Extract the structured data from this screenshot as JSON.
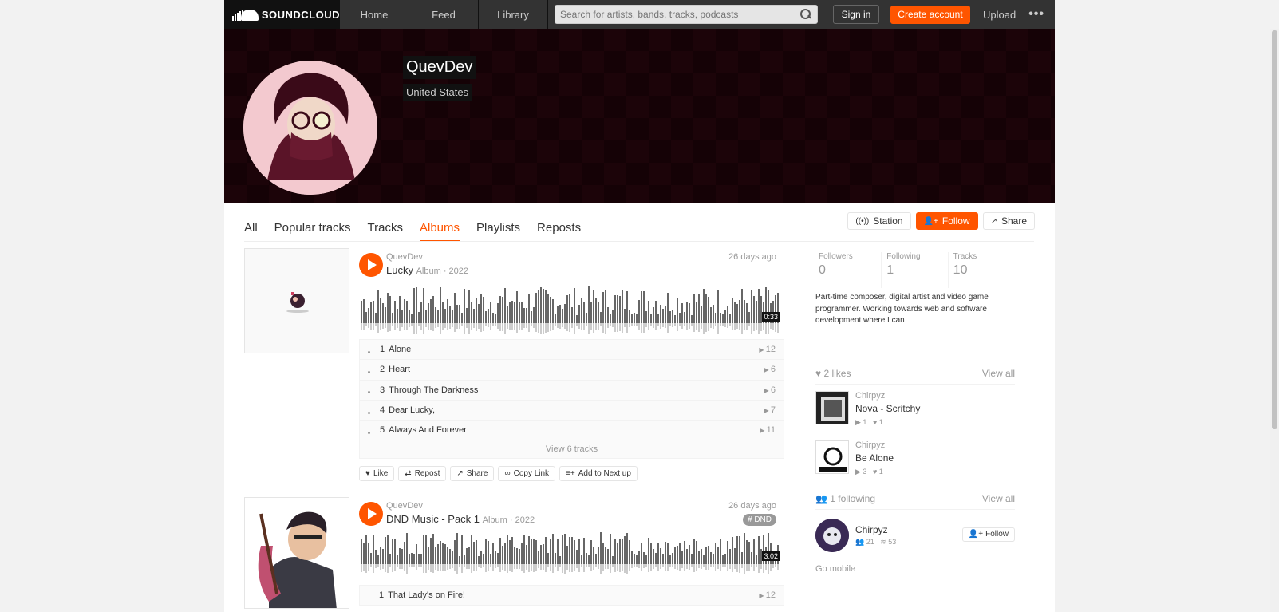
{
  "header": {
    "logo_text": "SOUNDCLOUD",
    "nav": [
      "Home",
      "Feed",
      "Library"
    ],
    "search_placeholder": "Search for artists, bands, tracks, podcasts",
    "signin": "Sign in",
    "create_account": "Create account",
    "upload": "Upload",
    "more": "•••"
  },
  "profile": {
    "username": "QuevDev",
    "location": "United States"
  },
  "tabs": [
    "All",
    "Popular tracks",
    "Tracks",
    "Albums",
    "Playlists",
    "Reposts"
  ],
  "active_tab": "Albums",
  "profile_actions": {
    "station": "Station",
    "follow": "Follow",
    "share": "Share"
  },
  "albums": [
    {
      "artist": "QuevDev",
      "title": "Lucky",
      "meta": "Album · 2022",
      "date": "26 days ago",
      "duration": "0:33",
      "tracks": [
        {
          "num": "1",
          "title": "Alone",
          "plays": "12"
        },
        {
          "num": "2",
          "title": "Heart",
          "plays": "6"
        },
        {
          "num": "3",
          "title": "Through The Darkness",
          "plays": "6"
        },
        {
          "num": "4",
          "title": "Dear Lucky,",
          "plays": "7"
        },
        {
          "num": "5",
          "title": "Always And Forever",
          "plays": "11"
        }
      ],
      "view_tracks": "View 6 tracks",
      "actions": [
        "Like",
        "Repost",
        "Share",
        "Copy Link",
        "Add to Next up"
      ]
    },
    {
      "artist": "QuevDev",
      "title": "DND Music - Pack 1",
      "meta": "Album · 2022",
      "date": "26 days ago",
      "tag": "# DND",
      "duration": "3:02",
      "tracks": [
        {
          "num": "1",
          "title": "That Lady's on Fire!",
          "plays": "12"
        }
      ]
    }
  ],
  "sidebar": {
    "stats": [
      {
        "label": "Followers",
        "value": "0"
      },
      {
        "label": "Following",
        "value": "1"
      },
      {
        "label": "Tracks",
        "value": "10"
      }
    ],
    "bio": "Part-time composer, digital artist and video game programmer. Working towards web and software development where I can",
    "likes_header": "2 likes",
    "view_all": "View all",
    "likes": [
      {
        "artist": "Chirpyz",
        "title": "Nova - Scritchy",
        "plays": "1",
        "likes": "1"
      },
      {
        "artist": "Chirpyz",
        "title": "Be Alone",
        "plays": "3",
        "likes": "1"
      }
    ],
    "following_header": "1 following",
    "following": [
      {
        "name": "Chirpyz",
        "followers": "21",
        "tracks": "53",
        "follow": "Follow"
      }
    ],
    "go_mobile": "Go mobile"
  }
}
